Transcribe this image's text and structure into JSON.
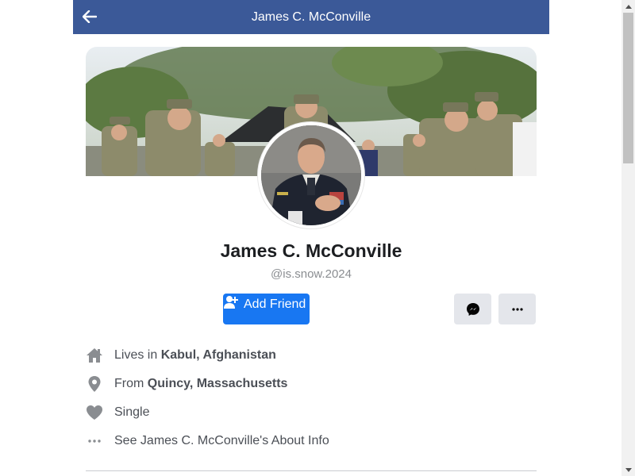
{
  "header": {
    "title": "James C. McConville"
  },
  "profile": {
    "name": "James C. McConville",
    "handle": "@is.snow.2024",
    "add_friend_label": "Add Friend"
  },
  "info": {
    "lives_prefix": "Lives in",
    "lives_place": "Kabul, Afghanistan",
    "from_prefix": "From",
    "from_place": "Quincy, Massachusetts",
    "relationship": "Single",
    "about_link": "See James C. McConville's About Info"
  },
  "colors": {
    "header_bg": "#3b5998",
    "primary": "#1877f2",
    "button_bg": "#e4e6eb",
    "icon": "#8a8d91"
  },
  "icons": [
    "back-arrow-icon",
    "add-friend-icon",
    "messenger-icon",
    "more-icon",
    "home-icon",
    "location-pin-icon",
    "heart-icon",
    "ellipsis-icon"
  ]
}
